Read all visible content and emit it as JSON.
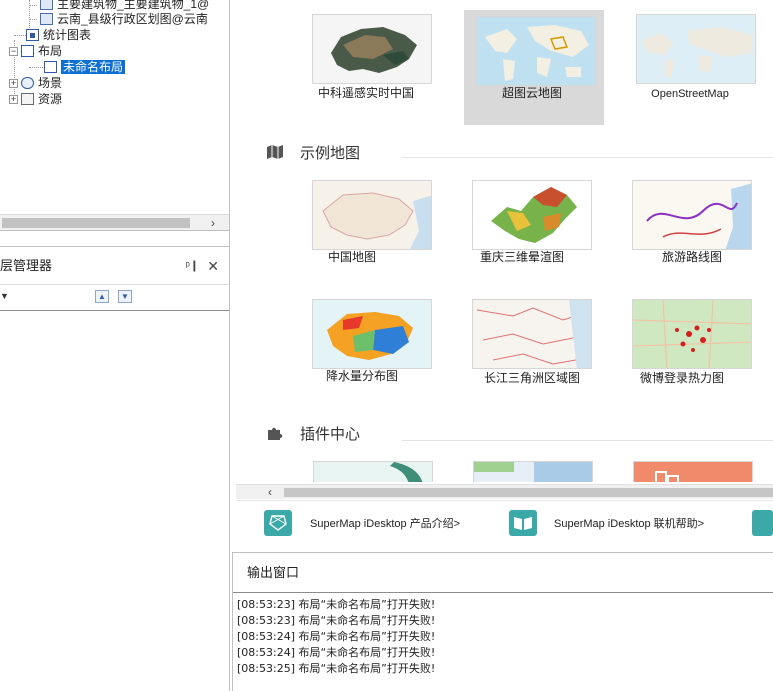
{
  "tree": {
    "items": [
      {
        "label": "主要建筑物_主要建筑物_1@"
      },
      {
        "label": "云南_县级行政区划图@云南"
      },
      {
        "label": "统计图表"
      },
      {
        "label": "布局"
      },
      {
        "label": "未命名布局"
      },
      {
        "label": "场景"
      },
      {
        "label": "资源"
      }
    ]
  },
  "layer_manager": {
    "title": "层管理器",
    "pin_icon": "pin-icon",
    "close_icon": "close-icon"
  },
  "base_maps": [
    {
      "label": "中科遥感实时中国"
    },
    {
      "label": "超图云地图"
    },
    {
      "label": "OpenStreetMap"
    }
  ],
  "sections": {
    "examples_title": "示例地图",
    "plugins_title": "插件中心"
  },
  "example_maps": [
    {
      "label": "中国地图"
    },
    {
      "label": "重庆三维晕渲图"
    },
    {
      "label": "旅游路线图"
    },
    {
      "label": "降水量分布图"
    },
    {
      "label": "长江三角洲区域图"
    },
    {
      "label": "微博登录热力图"
    }
  ],
  "links": [
    {
      "label": "SuperMap iDesktop 产品介绍>"
    },
    {
      "label": "SuperMap iDesktop 联机帮助>"
    }
  ],
  "output": {
    "title": "输出窗口",
    "lines": [
      "[08:53:23] 布局“未命名布局”打开失败!",
      "[08:53:23] 布局“未命名布局”打开失败!",
      "[08:53:24] 布局“未命名布局”打开失败!",
      "[08:53:24] 布局“未命名布局”打开失败!",
      "[08:53:25] 布局“未命名布局”打开失败!"
    ]
  },
  "colors": {
    "selection": "#0b6fd4",
    "highlight_card": "#d9d9d9",
    "link_icon_teal": "#3aa9a8"
  }
}
